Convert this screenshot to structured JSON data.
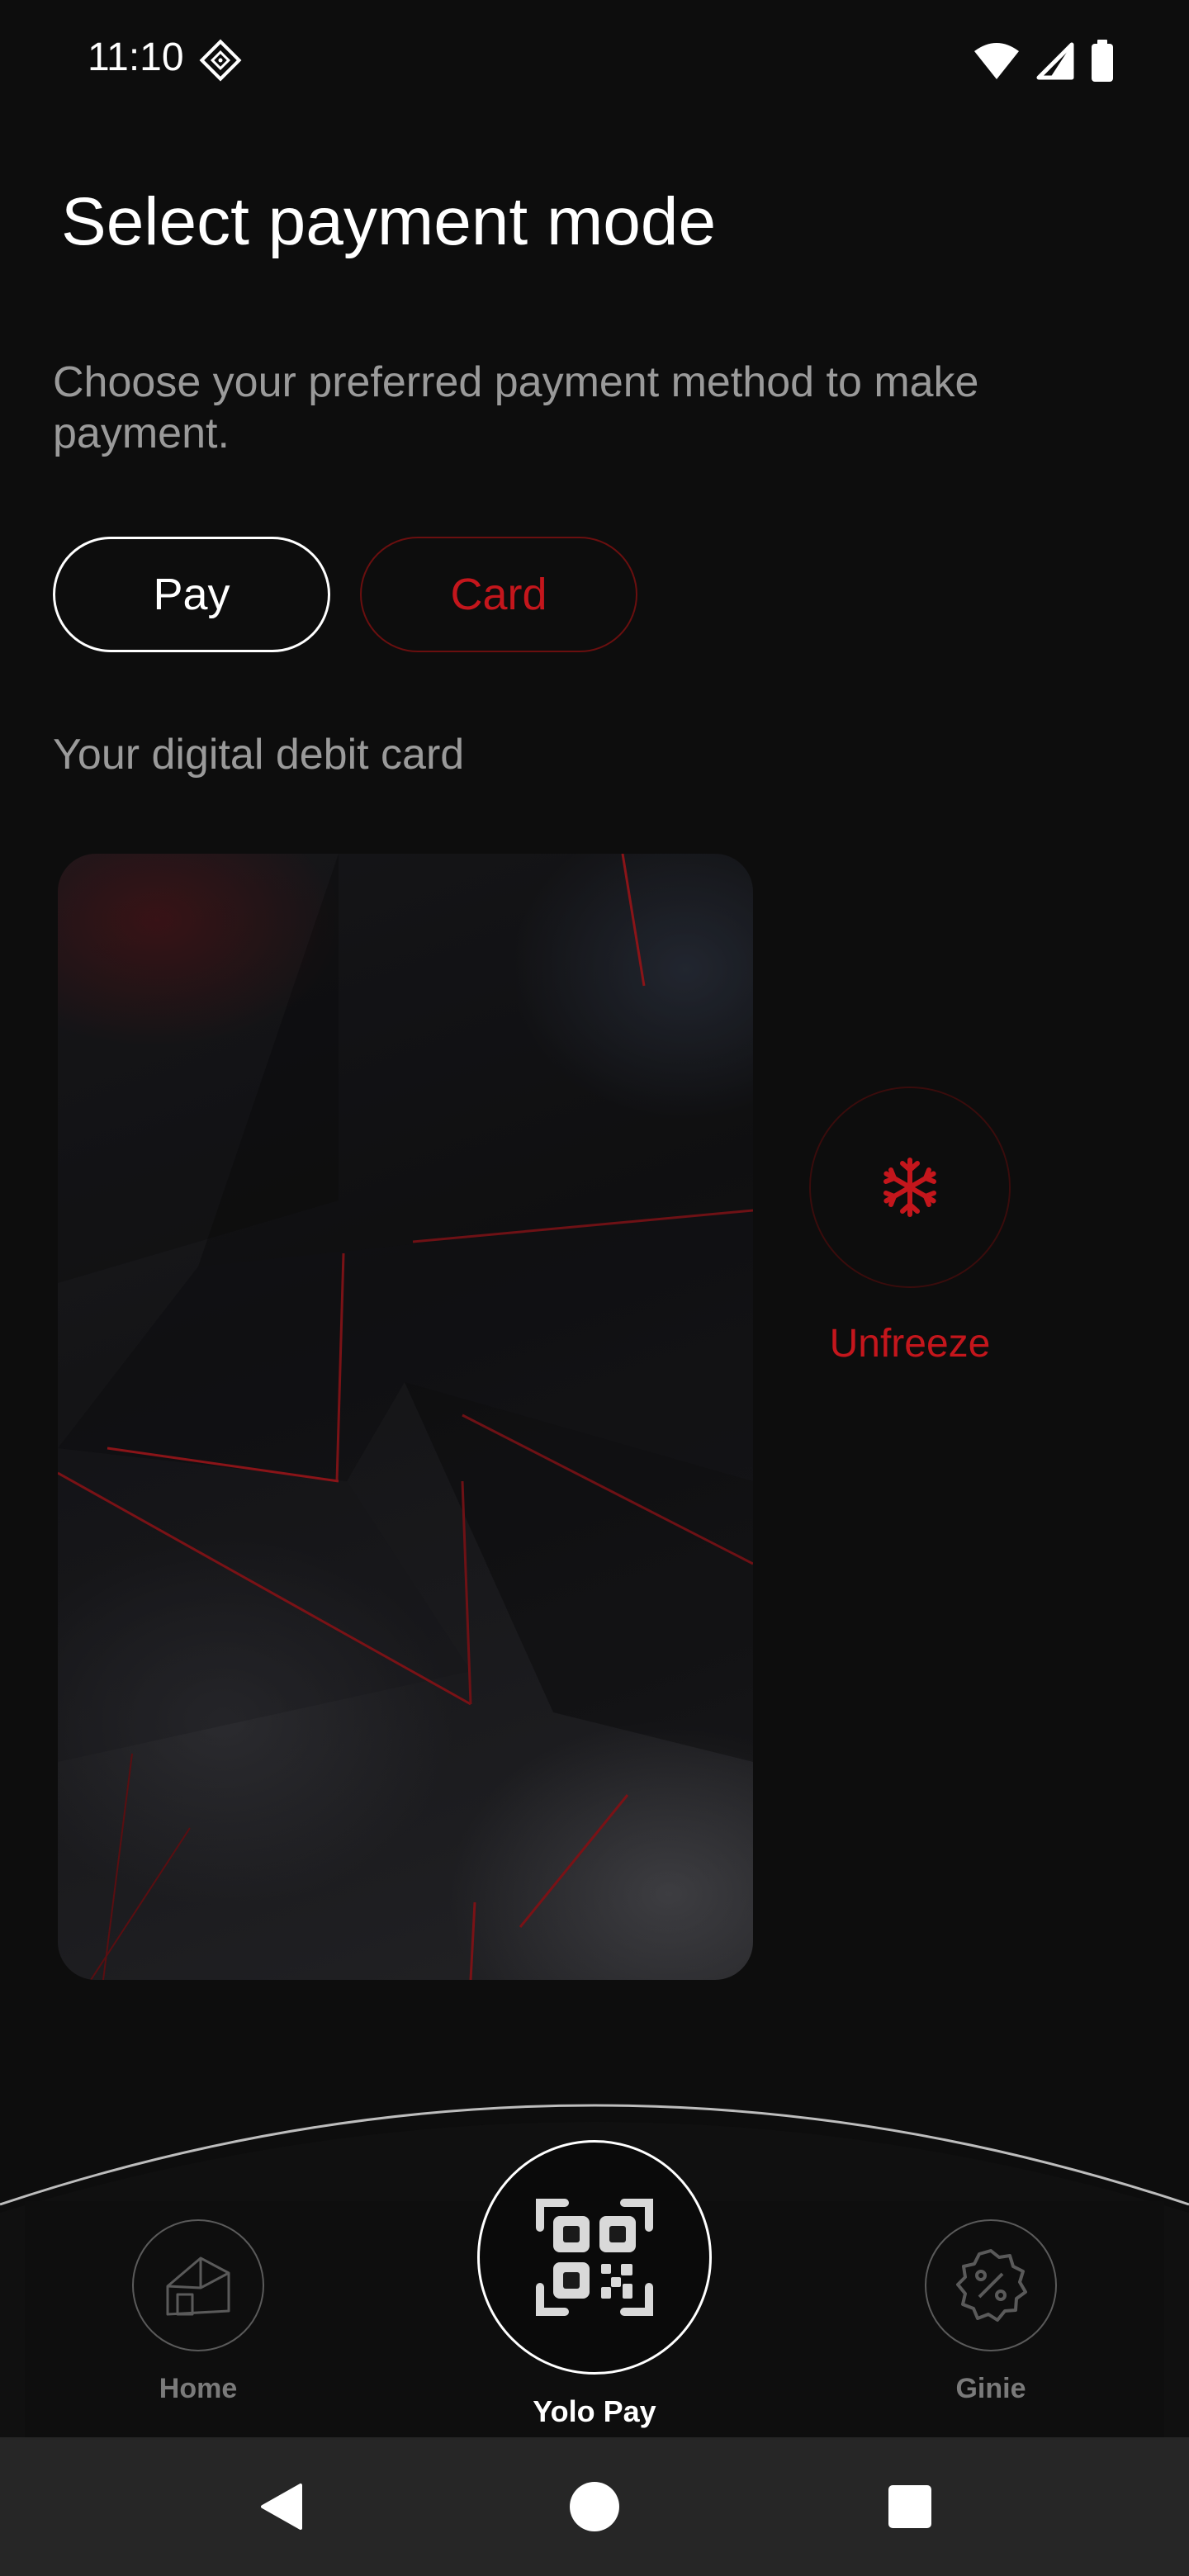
{
  "status_bar": {
    "time": "11:10",
    "icons": [
      "app-diamond-icon",
      "wifi-icon",
      "cell-signal-icon",
      "battery-icon"
    ]
  },
  "header": {
    "title": "Select payment mode",
    "subtitle": "Choose your preferred payment method to make payment."
  },
  "mode_toggle": {
    "options": [
      {
        "label": "Pay",
        "selected": true
      },
      {
        "label": "Card",
        "selected": false
      }
    ]
  },
  "card_section": {
    "label": "Your digital debit card"
  },
  "freeze_action": {
    "icon": "snowflake-icon",
    "label": "Unfreeze"
  },
  "bottom_nav": {
    "items": [
      {
        "label": "Home",
        "icon": "home-icon"
      },
      {
        "label": "Yolo Pay",
        "icon": "qr-code-icon"
      },
      {
        "label": "Ginie",
        "icon": "discount-badge-icon"
      }
    ]
  },
  "system_nav": {
    "icons": [
      "back-icon",
      "home-circle-icon",
      "recents-icon"
    ]
  },
  "colors": {
    "background": "#0d0d0d",
    "accent_red": "#c4161c",
    "muted_text": "#9a9a9a",
    "system_nav_bg": "#262626"
  }
}
